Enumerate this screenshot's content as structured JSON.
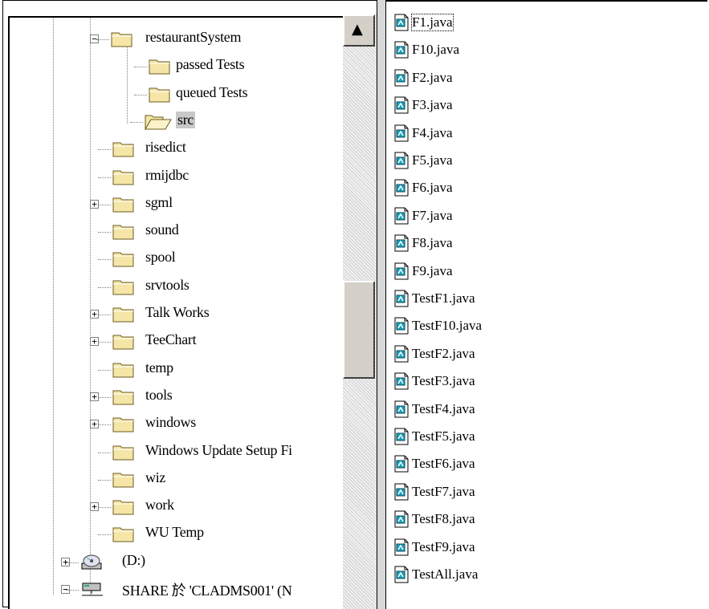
{
  "tree": {
    "items": [
      {
        "label": "restaurantSystem",
        "expander": "−"
      },
      {
        "label": "passed Tests"
      },
      {
        "label": "queued Tests"
      },
      {
        "label": "src",
        "selected": true,
        "open": true
      },
      {
        "label": "risedict"
      },
      {
        "label": "rmijdbc"
      },
      {
        "label": "sgml",
        "expander": "+"
      },
      {
        "label": "sound"
      },
      {
        "label": "spool"
      },
      {
        "label": "srvtools"
      },
      {
        "label": "Talk Works",
        "expander": "+"
      },
      {
        "label": "TeeChart",
        "expander": "+"
      },
      {
        "label": "temp"
      },
      {
        "label": "tools",
        "expander": "+"
      },
      {
        "label": "windows",
        "expander": "+"
      },
      {
        "label": "Windows Update Setup Fi"
      },
      {
        "label": "wiz"
      },
      {
        "label": "work",
        "expander": "+"
      },
      {
        "label": "WU Temp"
      },
      {
        "label": "(D:)",
        "expander": "+",
        "icon": "cd-drive-icon"
      },
      {
        "label": "SHARE 於 'CLADMS001' (N",
        "expander": "−",
        "icon": "network-drive-icon"
      }
    ]
  },
  "files": {
    "items": [
      "F1.java",
      "F10.java",
      "F2.java",
      "F3.java",
      "F4.java",
      "F5.java",
      "F6.java",
      "F7.java",
      "F8.java",
      "F9.java",
      "TestF1.java",
      "TestF10.java",
      "TestF2.java",
      "TestF3.java",
      "TestF4.java",
      "TestF5.java",
      "TestF6.java",
      "TestF7.java",
      "TestF8.java",
      "TestF9.java",
      "TestAll.java"
    ]
  },
  "scrollbar": {
    "up_arrow": "▲"
  },
  "colors": {
    "folder": "#f5e6a8",
    "folder_outline": "#6b5b1f",
    "selection": "#c8c8c8",
    "java_icon": "#1aa0b8"
  }
}
